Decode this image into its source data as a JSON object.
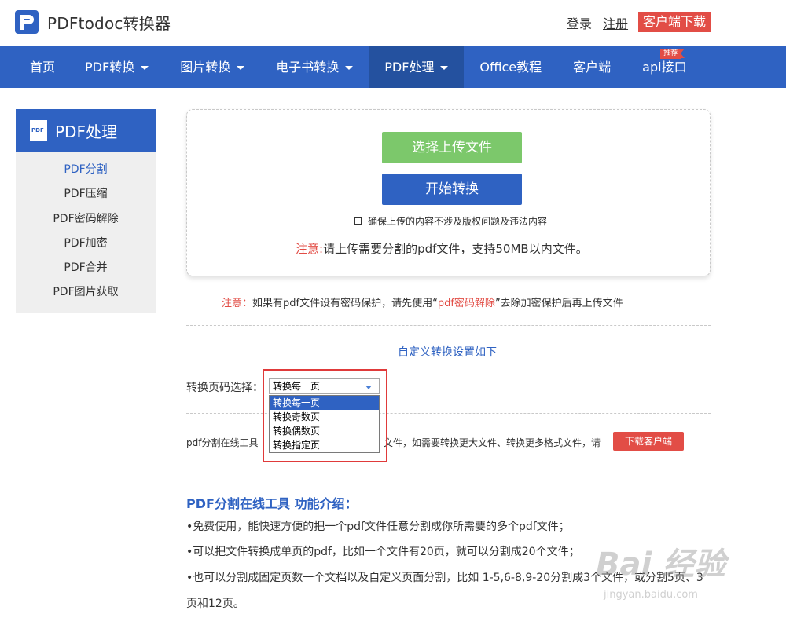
{
  "header": {
    "logo_text": "PDFtodoc转换器",
    "login": "登录",
    "register": "注册",
    "download": "客户端下载"
  },
  "nav": {
    "items": [
      {
        "label": "首页"
      },
      {
        "label": "PDF转换"
      },
      {
        "label": "图片转换"
      },
      {
        "label": "电子书转换"
      },
      {
        "label": "PDF处理"
      },
      {
        "label": "Office教程"
      },
      {
        "label": "客户端"
      },
      {
        "label": "api接口"
      }
    ],
    "badge": "推荐"
  },
  "sidebar": {
    "title": "PDF处理",
    "icon_text": "PDF",
    "items": [
      {
        "label": "PDF分割"
      },
      {
        "label": "PDF压缩"
      },
      {
        "label": "PDF密码解除"
      },
      {
        "label": "PDF加密"
      },
      {
        "label": "PDF合并"
      },
      {
        "label": "PDF图片获取"
      }
    ]
  },
  "upload": {
    "select_button": "选择上传文件",
    "start_button": "开始转换",
    "agree_text": "确保上传的内容不涉及版权问题及违法内容",
    "notice_prefix": "注意:",
    "notice_text": "请上传需要分割的pdf文件，支持50MB以内文件。"
  },
  "notice2": {
    "prefix": "注意：",
    "text1": "如果有pdf文件设有密码保护，请先使用“",
    "link": "pdf密码解除",
    "text2": "”去除加密保护后再上传文件"
  },
  "settings": {
    "title": "自定义转换设置如下",
    "label": "转换页码选择：",
    "selected": "转换每一页",
    "options": [
      "转换每一页",
      "转换奇数页",
      "转换偶数页",
      "转换指定页"
    ]
  },
  "client": {
    "text_left": "pdf分割在线工具",
    "text_right": "文件，如需要转换更大文件、转换更多格式文件，请",
    "button": "下载客户端"
  },
  "intro": {
    "title": "PDF分割在线工具 功能介绍：",
    "lines": [
      "•免费使用，能快速方便的把一个pdf文件任意分割成你所需要的多个pdf文件；",
      "•可以把文件转换成单页的pdf，比如一个文件有20页，就可以分割成20个文件；",
      "•也可以分割成固定页数一个文档以及自定义页面分割，比如 1-5,6-8,9-20分割成3个文件，或分割5页、3",
      "页和12页。"
    ]
  },
  "watermark": {
    "big": "Bai 经验",
    "small": "jingyan.baidu.com"
  },
  "colors": {
    "brand_blue": "#2f62c2",
    "nav_active": "#24519f",
    "green": "#7cc86b",
    "red": "#e24d46"
  }
}
